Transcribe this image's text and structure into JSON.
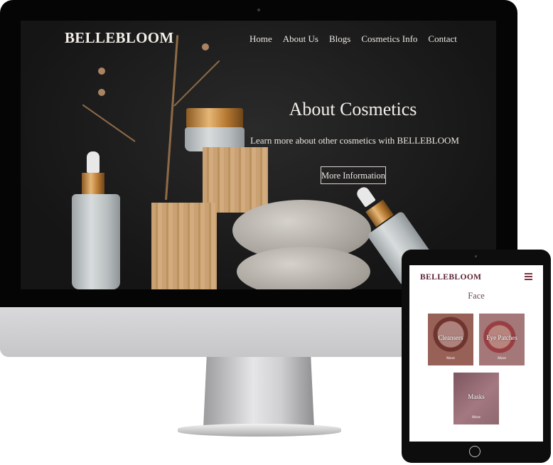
{
  "desktop": {
    "logo": "BELLEBLOOM",
    "nav": [
      "Home",
      "About Us",
      "Blogs",
      "Cosmetics Info",
      "Contact"
    ],
    "hero": {
      "title": "About Cosmetics",
      "subtitle": "Learn more about other cosmetics with BELLEBLOOM",
      "button": "More Information"
    }
  },
  "tablet": {
    "logo": "BELLEBLOOM",
    "menu_icon": "hamburger-icon",
    "section_title": "Face",
    "cards": [
      {
        "label": "Cleansers",
        "more": "More"
      },
      {
        "label": "Eye Patches",
        "more": "More"
      },
      {
        "label": "Masks",
        "more": "More"
      }
    ]
  }
}
